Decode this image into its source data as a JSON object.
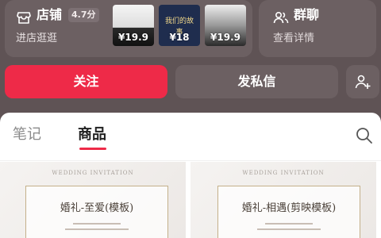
{
  "store": {
    "title": "店铺",
    "rating": "4.7分",
    "subtitle": "进店逛逛",
    "thumbnails": [
      {
        "price": "¥19.9"
      },
      {
        "price": "¥18",
        "art_text": "我们的故事"
      },
      {
        "price": "¥19.9"
      }
    ]
  },
  "group": {
    "title": "群聊",
    "subtitle": "查看详情"
  },
  "actions": {
    "follow_label": "关注",
    "message_label": "发私信"
  },
  "tabs": [
    {
      "label": "笔记",
      "active": false
    },
    {
      "label": "商品",
      "active": true
    }
  ],
  "products": [
    {
      "header": "WEDDING INVITATION",
      "title": "婚礼-至爱(模板)"
    },
    {
      "header": "WEDDING INVITATION",
      "title": "婚礼-相遇(剪映模板)"
    }
  ],
  "colors": {
    "accent": "#ee2a48",
    "background": "#5f5355",
    "card": "#6c6062"
  }
}
